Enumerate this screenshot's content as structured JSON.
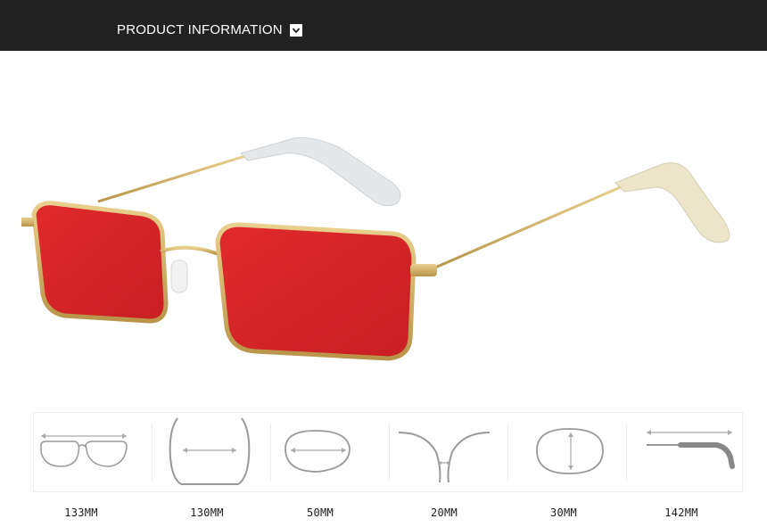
{
  "header": {
    "title": "PRODUCT INFORMATION",
    "icon": "chevron-down-icon",
    "background": "#222222"
  },
  "product": {
    "lens_color": "#d9262a",
    "frame_color": "#d4b36a"
  },
  "specs": [
    {
      "label": "133MM",
      "icon": "frame-width-icon"
    },
    {
      "label": "130MM",
      "icon": "temple-spread-icon"
    },
    {
      "label": "50MM",
      "icon": "lens-width-icon"
    },
    {
      "label": "20MM",
      "icon": "bridge-width-icon"
    },
    {
      "label": "30MM",
      "icon": "lens-height-icon"
    },
    {
      "label": "142MM",
      "icon": "temple-length-icon"
    }
  ]
}
